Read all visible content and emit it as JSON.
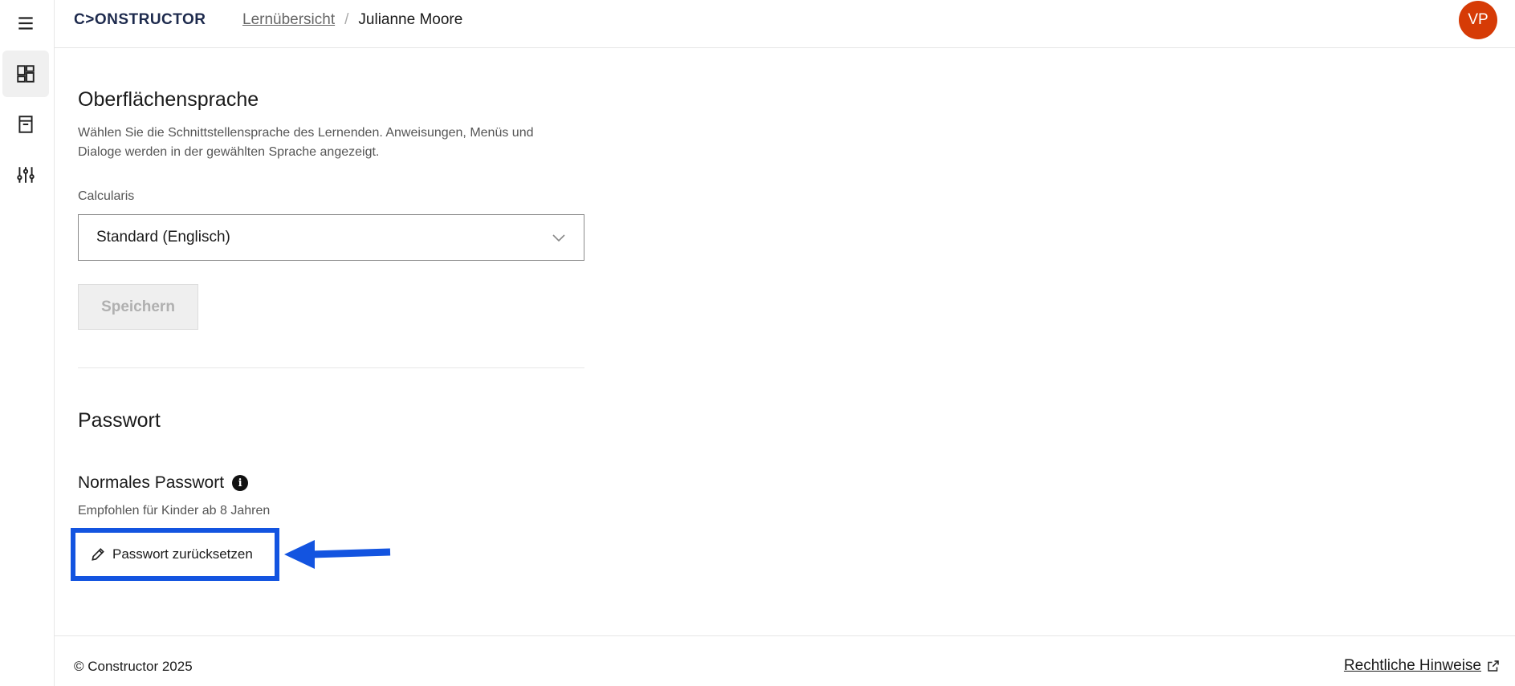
{
  "header": {
    "logo": "C>ONSTRUCTOR",
    "breadcrumb": {
      "parent": "Lernübersicht",
      "separator": "/",
      "current": "Julianne Moore"
    },
    "avatar_initials": "VP"
  },
  "sidebar": {
    "items": [
      {
        "icon": "menu-icon"
      },
      {
        "icon": "dashboard-icon",
        "active": true
      },
      {
        "icon": "book-icon"
      },
      {
        "icon": "sliders-icon"
      }
    ]
  },
  "language_section": {
    "title": "Oberflächensprache",
    "description": "Wählen Sie die Schnittstellensprache des Lernenden. Anweisungen, Menüs und Dialoge werden in der gewählten Sprache angezeigt.",
    "field_label": "Calcularis",
    "selected_value": "Standard (Englisch)",
    "save_label": "Speichern"
  },
  "password_section": {
    "title": "Passwort",
    "subtitle": "Normales Passwort",
    "hint": "Empfohlen für Kinder ab 8 Jahren",
    "reset_label": "Passwort zurücksetzen"
  },
  "footer": {
    "copyright": "© Constructor 2025",
    "legal_link": "Rechtliche Hinweise"
  },
  "colors": {
    "avatar": "#d63b06",
    "highlight": "#1354e0"
  }
}
